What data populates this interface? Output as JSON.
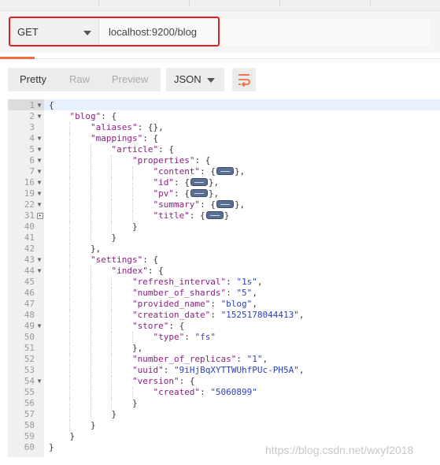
{
  "request": {
    "method": "GET",
    "url": "localhost:9200/blog"
  },
  "toolbar": {
    "tabs": [
      "Pretty",
      "Raw",
      "Preview"
    ],
    "format": "JSON",
    "wrap_icon": "wrap-lines-icon"
  },
  "editor": {
    "lines": [
      {
        "n": "1",
        "fold": "open",
        "tokens": [
          [
            "p",
            "{"
          ]
        ]
      },
      {
        "n": "2",
        "fold": "open",
        "tokens": [
          [
            "p",
            "    "
          ],
          [
            "k",
            "\"blog\""
          ],
          [
            "p",
            ": {"
          ]
        ]
      },
      {
        "n": "3",
        "fold": "",
        "tokens": [
          [
            "p",
            "        "
          ],
          [
            "k",
            "\"aliases\""
          ],
          [
            "p",
            ": {},"
          ]
        ]
      },
      {
        "n": "4",
        "fold": "open",
        "tokens": [
          [
            "p",
            "        "
          ],
          [
            "k",
            "\"mappings\""
          ],
          [
            "p",
            ": {"
          ]
        ]
      },
      {
        "n": "5",
        "fold": "open",
        "tokens": [
          [
            "p",
            "            "
          ],
          [
            "k",
            "\"article\""
          ],
          [
            "p",
            ": {"
          ]
        ]
      },
      {
        "n": "6",
        "fold": "open",
        "tokens": [
          [
            "p",
            "                "
          ],
          [
            "k",
            "\"properties\""
          ],
          [
            "p",
            ": {"
          ]
        ]
      },
      {
        "n": "7",
        "fold": "closed",
        "tokens": [
          [
            "p",
            "                    "
          ],
          [
            "k",
            "\"content\""
          ],
          [
            "p",
            ": {"
          ],
          [
            "c",
            ""
          ],
          [
            "p",
            "},"
          ]
        ]
      },
      {
        "n": "16",
        "fold": "closed",
        "tokens": [
          [
            "p",
            "                    "
          ],
          [
            "k",
            "\"id\""
          ],
          [
            "p",
            ": {"
          ],
          [
            "c",
            ""
          ],
          [
            "p",
            "},"
          ]
        ]
      },
      {
        "n": "19",
        "fold": "closed",
        "tokens": [
          [
            "p",
            "                    "
          ],
          [
            "k",
            "\"pv\""
          ],
          [
            "p",
            ": {"
          ],
          [
            "c",
            ""
          ],
          [
            "p",
            "},"
          ]
        ]
      },
      {
        "n": "22",
        "fold": "closed",
        "tokens": [
          [
            "p",
            "                    "
          ],
          [
            "k",
            "\"summary\""
          ],
          [
            "p",
            ": {"
          ],
          [
            "c",
            ""
          ],
          [
            "p",
            "},"
          ]
        ]
      },
      {
        "n": "31",
        "fold": "box",
        "tokens": [
          [
            "p",
            "                    "
          ],
          [
            "k",
            "\"title\""
          ],
          [
            "p",
            ": {"
          ],
          [
            "c",
            ""
          ],
          [
            "p",
            "}"
          ]
        ]
      },
      {
        "n": "40",
        "fold": "",
        "tokens": [
          [
            "p",
            "                }"
          ]
        ]
      },
      {
        "n": "41",
        "fold": "",
        "tokens": [
          [
            "p",
            "            }"
          ]
        ]
      },
      {
        "n": "42",
        "fold": "",
        "tokens": [
          [
            "p",
            "        },"
          ]
        ]
      },
      {
        "n": "43",
        "fold": "open",
        "tokens": [
          [
            "p",
            "        "
          ],
          [
            "k",
            "\"settings\""
          ],
          [
            "p",
            ": {"
          ]
        ]
      },
      {
        "n": "44",
        "fold": "open",
        "tokens": [
          [
            "p",
            "            "
          ],
          [
            "k",
            "\"index\""
          ],
          [
            "p",
            ": {"
          ]
        ]
      },
      {
        "n": "45",
        "fold": "",
        "tokens": [
          [
            "p",
            "                "
          ],
          [
            "k",
            "\"refresh_interval\""
          ],
          [
            "p",
            ": "
          ],
          [
            "s",
            "\"1s\""
          ],
          [
            "p",
            ","
          ]
        ]
      },
      {
        "n": "46",
        "fold": "",
        "tokens": [
          [
            "p",
            "                "
          ],
          [
            "k",
            "\"number_of_shards\""
          ],
          [
            "p",
            ": "
          ],
          [
            "s",
            "\"5\""
          ],
          [
            "p",
            ","
          ]
        ]
      },
      {
        "n": "47",
        "fold": "",
        "tokens": [
          [
            "p",
            "                "
          ],
          [
            "k",
            "\"provided_name\""
          ],
          [
            "p",
            ": "
          ],
          [
            "s",
            "\"blog\""
          ],
          [
            "p",
            ","
          ]
        ]
      },
      {
        "n": "48",
        "fold": "",
        "tokens": [
          [
            "p",
            "                "
          ],
          [
            "k",
            "\"creation_date\""
          ],
          [
            "p",
            ": "
          ],
          [
            "s",
            "\"1525178044413\""
          ],
          [
            "p",
            ","
          ]
        ]
      },
      {
        "n": "49",
        "fold": "open",
        "tokens": [
          [
            "p",
            "                "
          ],
          [
            "k",
            "\"store\""
          ],
          [
            "p",
            ": {"
          ]
        ]
      },
      {
        "n": "50",
        "fold": "",
        "tokens": [
          [
            "p",
            "                    "
          ],
          [
            "k",
            "\"type\""
          ],
          [
            "p",
            ": "
          ],
          [
            "s",
            "\"fs\""
          ]
        ]
      },
      {
        "n": "51",
        "fold": "",
        "tokens": [
          [
            "p",
            "                },"
          ]
        ]
      },
      {
        "n": "52",
        "fold": "",
        "tokens": [
          [
            "p",
            "                "
          ],
          [
            "k",
            "\"number_of_replicas\""
          ],
          [
            "p",
            ": "
          ],
          [
            "s",
            "\"1\""
          ],
          [
            "p",
            ","
          ]
        ]
      },
      {
        "n": "53",
        "fold": "",
        "tokens": [
          [
            "p",
            "                "
          ],
          [
            "k",
            "\"uuid\""
          ],
          [
            "p",
            ": "
          ],
          [
            "s",
            "\"9iHjBqXYTTWUhfPUc-PH5A\""
          ],
          [
            "p",
            ","
          ]
        ]
      },
      {
        "n": "54",
        "fold": "open",
        "tokens": [
          [
            "p",
            "                "
          ],
          [
            "k",
            "\"version\""
          ],
          [
            "p",
            ": {"
          ]
        ]
      },
      {
        "n": "55",
        "fold": "",
        "tokens": [
          [
            "p",
            "                    "
          ],
          [
            "k",
            "\"created\""
          ],
          [
            "p",
            ": "
          ],
          [
            "s",
            "\"5060899\""
          ]
        ]
      },
      {
        "n": "56",
        "fold": "",
        "tokens": [
          [
            "p",
            "                }"
          ]
        ]
      },
      {
        "n": "57",
        "fold": "",
        "tokens": [
          [
            "p",
            "            }"
          ]
        ]
      },
      {
        "n": "58",
        "fold": "",
        "tokens": [
          [
            "p",
            "        }"
          ]
        ]
      },
      {
        "n": "59",
        "fold": "",
        "tokens": [
          [
            "p",
            "    }"
          ]
        ]
      },
      {
        "n": "60",
        "fold": "",
        "tokens": [
          [
            "p",
            "}"
          ]
        ]
      }
    ]
  },
  "watermark": "https://blog.csdn.net/wxyf2018",
  "colors": {
    "accent": "#f26b3a",
    "highlight": "#e02020",
    "json_key": "#8a1f7d",
    "json_string": "#2a3fbf"
  }
}
